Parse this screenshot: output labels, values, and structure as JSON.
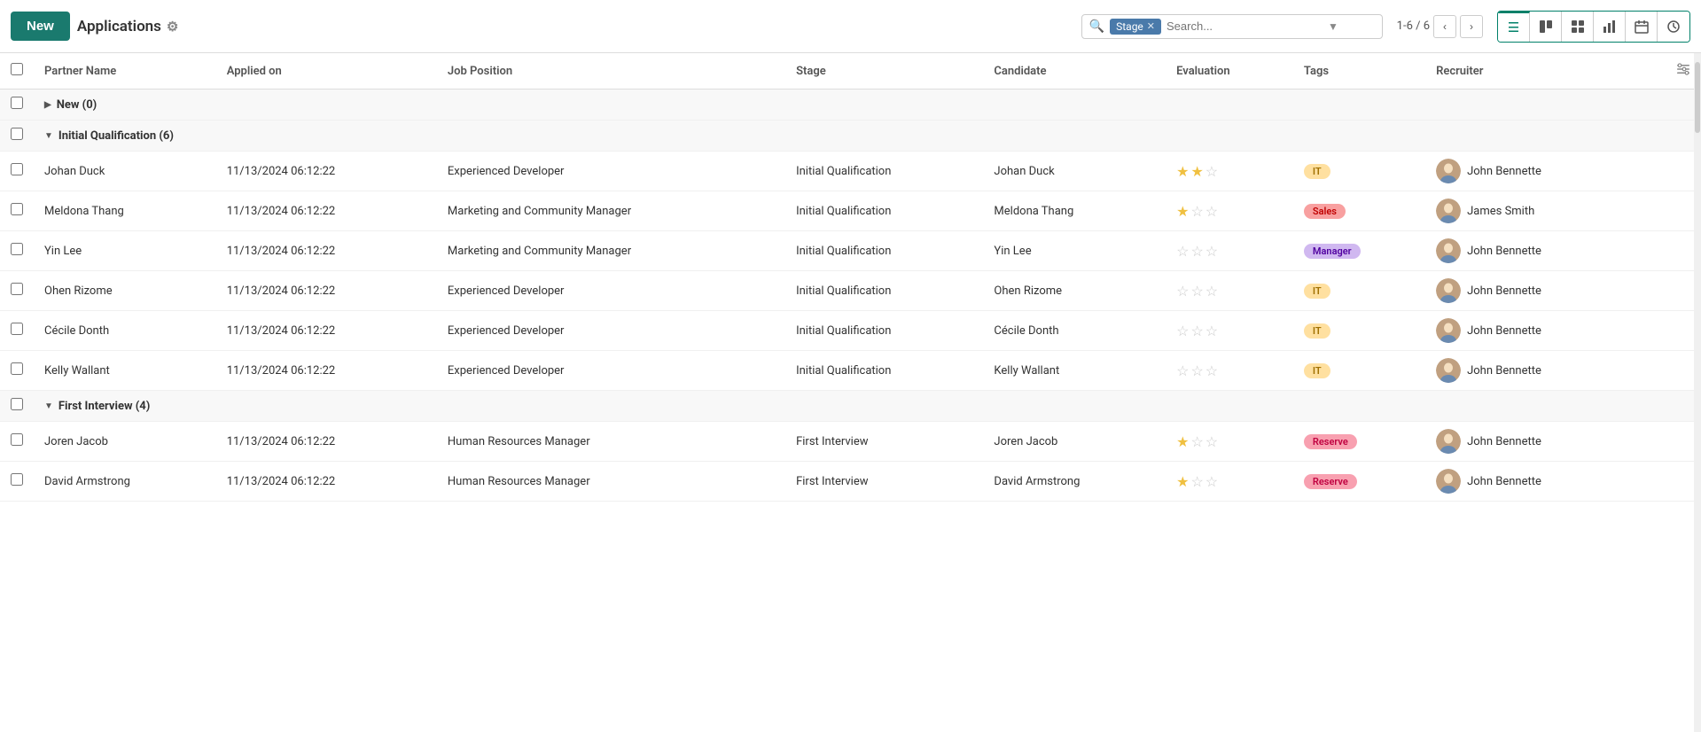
{
  "header": {
    "new_label": "New",
    "title": "Applications",
    "gear_icon": "⚙",
    "search_placeholder": "Search...",
    "stage_filter": "Stage",
    "pagination": "1-6 / 6",
    "view_icons": [
      "☰",
      "⊞",
      "▦",
      "▁",
      "▦",
      "⏱"
    ]
  },
  "columns": [
    {
      "id": "partner_name",
      "label": "Partner Name"
    },
    {
      "id": "applied_on",
      "label": "Applied on"
    },
    {
      "id": "job_position",
      "label": "Job Position"
    },
    {
      "id": "stage",
      "label": "Stage"
    },
    {
      "id": "candidate",
      "label": "Candidate"
    },
    {
      "id": "evaluation",
      "label": "Evaluation"
    },
    {
      "id": "tags",
      "label": "Tags"
    },
    {
      "id": "recruiter",
      "label": "Recruiter"
    }
  ],
  "groups": [
    {
      "label": "New",
      "count": 0,
      "collapsed": true,
      "rows": []
    },
    {
      "label": "Initial Qualification",
      "count": 6,
      "collapsed": false,
      "rows": [
        {
          "partner_name": "Johan Duck",
          "applied_on": "11/13/2024 06:12:22",
          "job_position": "Experienced Developer",
          "stage": "Initial Qualification",
          "candidate": "Johan Duck",
          "stars": [
            true,
            true,
            false
          ],
          "tag": "IT",
          "tag_type": "it",
          "recruiter": "John Bennette"
        },
        {
          "partner_name": "Meldona Thang",
          "applied_on": "11/13/2024 06:12:22",
          "job_position": "Marketing and Community Manager",
          "stage": "Initial Qualification",
          "candidate": "Meldona Thang",
          "stars": [
            true,
            false,
            false
          ],
          "tag": "Sales",
          "tag_type": "sales",
          "recruiter": "James Smith"
        },
        {
          "partner_name": "Yin Lee",
          "applied_on": "11/13/2024 06:12:22",
          "job_position": "Marketing and Community Manager",
          "stage": "Initial Qualification",
          "candidate": "Yin Lee",
          "stars": [
            false,
            false,
            false
          ],
          "tag": "Manager",
          "tag_type": "manager",
          "recruiter": "John Bennette"
        },
        {
          "partner_name": "Ohen Rizome",
          "applied_on": "11/13/2024 06:12:22",
          "job_position": "Experienced Developer",
          "stage": "Initial Qualification",
          "candidate": "Ohen Rizome",
          "stars": [
            false,
            false,
            false
          ],
          "tag": "IT",
          "tag_type": "it",
          "recruiter": "John Bennette"
        },
        {
          "partner_name": "Cécile Donth",
          "applied_on": "11/13/2024 06:12:22",
          "job_position": "Experienced Developer",
          "stage": "Initial Qualification",
          "candidate": "Cécile Donth",
          "stars": [
            false,
            false,
            false
          ],
          "tag": "IT",
          "tag_type": "it",
          "recruiter": "John Bennette"
        },
        {
          "partner_name": "Kelly Wallant",
          "applied_on": "11/13/2024 06:12:22",
          "job_position": "Experienced Developer",
          "stage": "Initial Qualification",
          "candidate": "Kelly Wallant",
          "stars": [
            false,
            false,
            false
          ],
          "tag": "IT",
          "tag_type": "it",
          "recruiter": "John Bennette"
        }
      ]
    },
    {
      "label": "First Interview",
      "count": 4,
      "collapsed": false,
      "rows": [
        {
          "partner_name": "Joren Jacob",
          "applied_on": "11/13/2024 06:12:22",
          "job_position": "Human Resources Manager",
          "stage": "First Interview",
          "candidate": "Joren Jacob",
          "stars": [
            true,
            false,
            false
          ],
          "tag": "Reserve",
          "tag_type": "reserve",
          "recruiter": "John Bennette"
        },
        {
          "partner_name": "David Armstrong",
          "applied_on": "11/13/2024 06:12:22",
          "job_position": "Human Resources Manager",
          "stage": "First Interview",
          "candidate": "David Armstrong",
          "stars": [
            true,
            false,
            false
          ],
          "tag": "Reserve",
          "tag_type": "reserve",
          "recruiter": "John Bennette"
        }
      ]
    }
  ],
  "colors": {
    "primary": "#1a7a6e",
    "border": "#008069"
  }
}
